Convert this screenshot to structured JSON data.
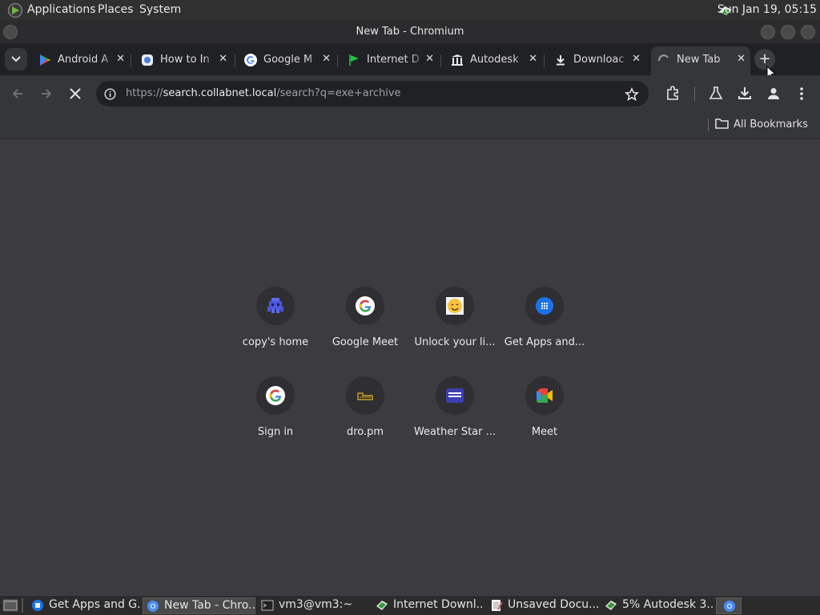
{
  "top_panel": {
    "menus": [
      "Applications",
      "Places",
      "System"
    ],
    "clock": "Sun Jan 19, 05:15"
  },
  "window": {
    "title": "New Tab - Chromium"
  },
  "tabs": [
    {
      "label": "Android A",
      "icon": "google-play-icon"
    },
    {
      "label": "How to In",
      "icon": "site-icon"
    },
    {
      "label": "Google M",
      "icon": "google-icon"
    },
    {
      "label": "Internet D",
      "icon": "green-flag-icon"
    },
    {
      "label": "Autodesk",
      "icon": "library-icon"
    },
    {
      "label": "Downloac",
      "icon": "download-icon"
    },
    {
      "label": "New Tab",
      "icon": "loading-spinner-icon",
      "active": true
    }
  ],
  "toolbar": {
    "url_prefix": "https://",
    "url_host": "search.collabnet.local",
    "url_path": "/search?q=exe+archive"
  },
  "bookmarks": {
    "all_label": "All Bookmarks"
  },
  "shortcuts": [
    {
      "label": "copy's home",
      "icon": "pixel-invader-icon"
    },
    {
      "label": "Google Meet",
      "icon": "google-icon"
    },
    {
      "label": "Unlock your li...",
      "icon": "emoji-face-icon"
    },
    {
      "label": "Get Apps and...",
      "icon": "apps-grid-icon"
    },
    {
      "label": "Sign in",
      "icon": "google-icon"
    },
    {
      "label": "dro.pm",
      "icon": "dro-pm-icon"
    },
    {
      "label": "Weather Star ...",
      "icon": "weather-star-icon"
    },
    {
      "label": "Meet",
      "icon": "google-meet-icon"
    }
  ],
  "taskbar": [
    {
      "label": "Get Apps and G...",
      "icon": "apps-icon"
    },
    {
      "label": "New Tab - Chro...",
      "icon": "chromium-icon",
      "active": true
    },
    {
      "label": "vm3@vm3:~",
      "icon": "terminal-icon"
    },
    {
      "label": "Internet Downl...",
      "icon": "idm-icon"
    },
    {
      "label": "Unsaved Docu...",
      "icon": "text-editor-icon"
    },
    {
      "label": "5% Autodesk 3...",
      "icon": "idm-icon"
    }
  ],
  "colors": {
    "panel": "#303030",
    "tabstrip": "#202124",
    "toolbar": "#35363a",
    "content": "#3c3c40"
  }
}
